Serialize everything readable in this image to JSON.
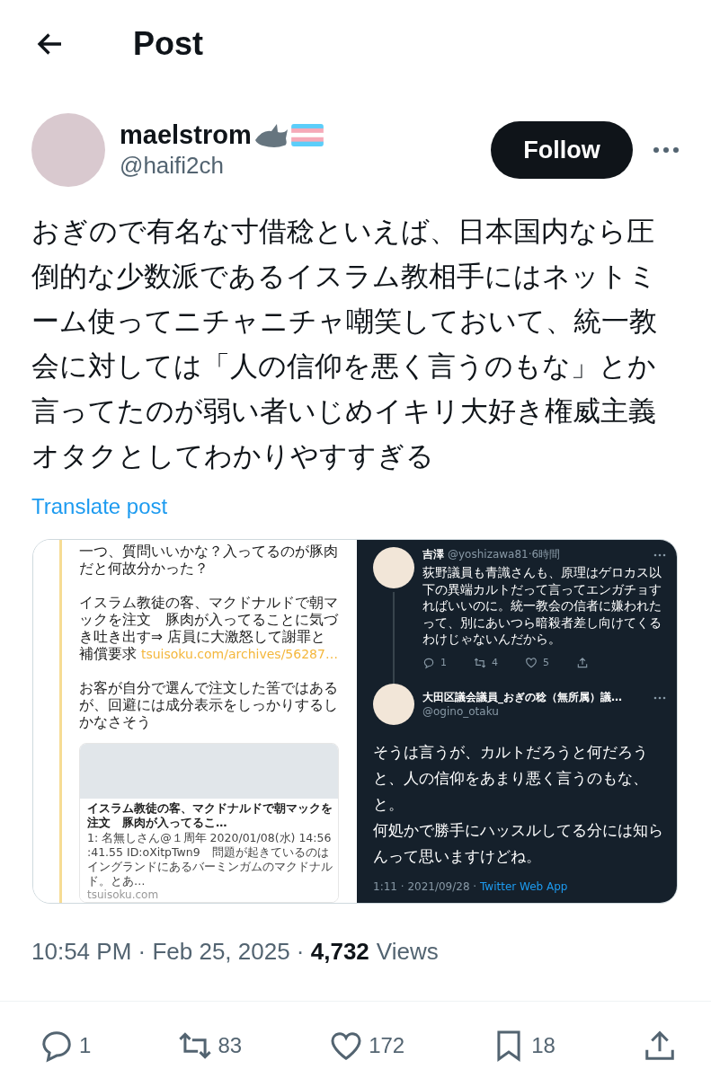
{
  "header": {
    "title": "Post"
  },
  "author": {
    "name": "maelstrom",
    "handle": "@haifi2ch",
    "follow": "Follow"
  },
  "text": "おぎので有名な寸借稔といえば、日本国内なら圧倒的な少数派であるイスラム教相手にはネットミーム使ってニチャニチャ嘲笑しておいて、統一教会に対しては「人の信仰を悪く言うのもな」とか言ってたのが弱い者いじめイキリ大好き権威主義オタクとしてわかりやすすぎる",
  "translate": "Translate post",
  "media": {
    "left": {
      "paragraphs": [
        {
          "text": "一つ、質問いいかな？入ってるのが豚肉だと何故分かった？"
        },
        {
          "text": "イスラム教徒の客、マクドナルドで朝マックを注文　豚肉が入ってることに気づき吐き出す⇒ 店員に大激怒して謝罪と補償要求 ",
          "link": "tsuisoku.com/archives/56287…"
        },
        {
          "text": "お客が自分で選んで注文した筈ではあるが、回避には成分表示をしっかりするしかなさそう"
        }
      ],
      "card": {
        "title": "イスラム教徒の客、マクドナルドで朝マックを注文　豚肉が入ってるこ…",
        "snippet": "1: 名無しさん@１周年 2020/01/08(水) 14:56:41.55 ID:oXitpTwn9　問題が起きているのはイングランドにあるバーミンガムのマクドナルド。とあ…",
        "domain": "tsuisoku.com"
      }
    },
    "right": {
      "tweets": [
        {
          "kind": "reply",
          "name": "吉澤",
          "handle": "@yoshizawa81·6時間",
          "text": "荻野議員も青識さんも、原理はゲロカス以下の異端カルトだって言ってエンガチョすればいいのに。統一教会の信者に嫌われたって、別にあいつら暗殺者差し向けてくるわけじゃないんだから。",
          "counts": [
            "1",
            "4",
            "5"
          ]
        },
        {
          "kind": "main",
          "name": "大田区議会議員_おぎの稔（無所属）議…",
          "handle": "@ogino_otaku",
          "lines": [
            "そうは言うが、カルトだろうと何だろうと、人の信仰をあまり悪く言うのもな、と。",
            "何処かで勝手にハッスルしてる分には知らんって思いますけどね。"
          ],
          "time": "1:11 · 2021/09/28 · ",
          "source": "Twitter Web App"
        }
      ]
    }
  },
  "meta": {
    "datetime": "10:54 PM · Feb 25, 2025 · ",
    "views": "4,732",
    "views_label": "Views"
  },
  "actions": [
    {
      "kind": "reply",
      "count": "1"
    },
    {
      "kind": "repost",
      "count": "83"
    },
    {
      "kind": "like",
      "count": "172"
    },
    {
      "kind": "bookmark",
      "count": "18"
    },
    {
      "kind": "share"
    }
  ]
}
